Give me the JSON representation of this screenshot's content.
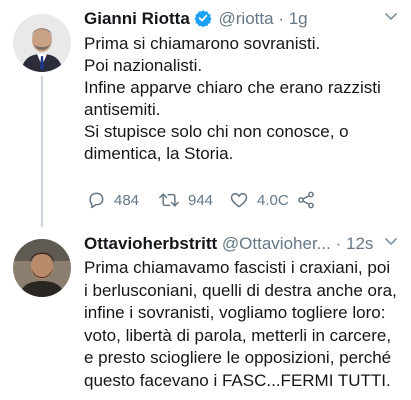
{
  "tweet1": {
    "name": "Gianni Riotta",
    "handle": "@riotta",
    "separator": "·",
    "time": "1g",
    "lines": [
      "Prima si chiamarono sovranisti.",
      "Poi nazionalisti.",
      "Infine apparve chiaro che erano razzisti",
      "antisemiti.",
      "Si stupisce solo chi non conosce, o",
      "dimentica, la Storia."
    ],
    "replies": "484",
    "retweets": "944",
    "likes": "4.0C"
  },
  "tweet2": {
    "name": "Ottavioherbstritt",
    "handle": "@Ottavioher...",
    "separator": "·",
    "time": "12s",
    "lines": [
      "Prima chiamavamo fascisti i craxiani, poi",
      "i berlusconiani, quelli di destra anche ora,",
      "infine i sovranisti, vogliamo togliere loro:",
      "voto, libertà di parola, metterli in carcere,",
      "e presto sciogliere le opposizioni, perché",
      "questo facevano i FASC...FERMI TUTTI."
    ]
  },
  "colors": {
    "accent": "#1da1f2",
    "muted": "#657786",
    "text": "#14171a",
    "line": "#ccd6dd"
  }
}
